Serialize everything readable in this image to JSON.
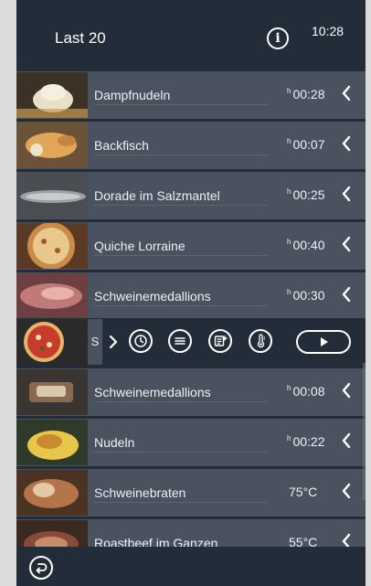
{
  "header": {
    "title": "Last 20",
    "clock": "10:28",
    "info_icon_glyph": "i"
  },
  "list": {
    "items": [
      {
        "name": "Dampfnudeln",
        "time": "00:28",
        "time_prefix": "h",
        "thumb": "dumpling",
        "colors": [
          "#3b3125",
          "#e9dfc6",
          "#c79b55"
        ]
      },
      {
        "name": "Backfisch",
        "time": "00:07",
        "time_prefix": "h",
        "thumb": "fried-fish",
        "colors": [
          "#6b5238",
          "#e0a65a",
          "#f0e2c4"
        ]
      },
      {
        "name": "Dorade im Salzmantel",
        "time": "00:25",
        "time_prefix": "h",
        "thumb": "fish-salt",
        "colors": [
          "#4a4d52",
          "#9aa0a6",
          "#c8cccf"
        ]
      },
      {
        "name": "Quiche Lorraine",
        "time": "00:40",
        "time_prefix": "h",
        "thumb": "quiche",
        "colors": [
          "#5b3a25",
          "#c98a4a",
          "#e8c98b"
        ]
      },
      {
        "name": "Schweinemedallions",
        "time": "00:30",
        "time_prefix": "h",
        "thumb": "raw-meat",
        "colors": [
          "#6e3f40",
          "#c07a78",
          "#e8b1ad"
        ]
      },
      {
        "name": "S",
        "expanded": true,
        "thumb": "pizza",
        "colors": [
          "#2b2a2a",
          "#c63b2c",
          "#e6b36a"
        ]
      },
      {
        "name": "Schweinemedallions",
        "time": "00:08",
        "time_prefix": "h",
        "thumb": "grilled-meat",
        "colors": [
          "#3a3531",
          "#8a6a4e",
          "#d9c7b0"
        ]
      },
      {
        "name": "Nudeln",
        "time": "00:22",
        "time_prefix": "h",
        "thumb": "pasta",
        "colors": [
          "#2f3a2a",
          "#e8c64a",
          "#c98a32"
        ]
      },
      {
        "name": "Schweinebraten",
        "time": "75°C",
        "time_prefix": "",
        "thumb": "roast",
        "colors": [
          "#4a3323",
          "#b5734a",
          "#e5c9a6"
        ]
      },
      {
        "name": "Roastbeef im Ganzen",
        "time": "55°C",
        "time_prefix": "",
        "thumb": "roastbeef",
        "colors": [
          "#3a2a22",
          "#8a4a3a",
          "#c98a6a"
        ]
      }
    ]
  },
  "expanded_actions": {
    "icons": [
      "clock-icon",
      "list-icon",
      "recipe-add-icon",
      "thermometer-icon"
    ],
    "play": "play-icon"
  },
  "footer": {
    "back_icon": "back-arrow-icon"
  },
  "colors": {
    "background": "#232d3a",
    "row": "#4a5260",
    "text": "#eef0f3",
    "outer": "#dcdcdc"
  }
}
